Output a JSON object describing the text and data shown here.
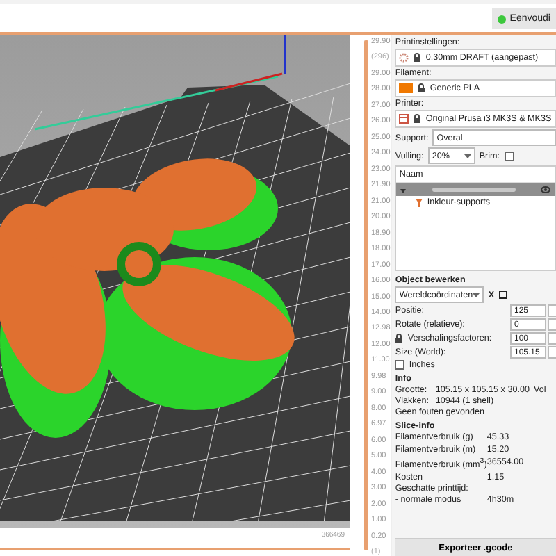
{
  "topbar": {
    "mode": {
      "label": "Eenvoudi",
      "color": "#3cc83c"
    }
  },
  "viewport": {
    "footer": "366469"
  },
  "horizontal_slider": {
    "level": 1
  },
  "layer_slider": {
    "level": 1,
    "top_label": "29.90",
    "top_sub": "(296)",
    "ticks": [
      "29.00",
      "28.00",
      "27.00",
      "26.00",
      "25.00",
      "24.00",
      "23.00",
      "21.90",
      "21.00",
      "20.00",
      "18.90",
      "18.00",
      "17.00",
      "16.00",
      "15.00",
      "14.00",
      "12.98",
      "12.00",
      "11.00",
      "9.98",
      "9.00",
      "8.00",
      "6.97",
      "6.00",
      "5.00",
      "4.00",
      "3.00",
      "2.00",
      "1.00"
    ],
    "bottom_label": "0.20",
    "bottom_sub": "(1)"
  },
  "panel": {
    "print_settings": {
      "label": "Printinstellingen:",
      "value": "0.30mm DRAFT (aangepast)"
    },
    "filament": {
      "label": "Filament:",
      "value": "Generic PLA",
      "color": "#f07800"
    },
    "printer": {
      "label": "Printer:",
      "value": "Original Prusa i3 MK3S & MK3S"
    },
    "support": {
      "label": "Support:",
      "value": "Overal"
    },
    "infill": {
      "label": "Vulling:",
      "value": "20%"
    },
    "brim": {
      "label": "Brim:",
      "checked": false
    },
    "object_list": {
      "header": "Naam",
      "items": [
        {
          "selected": true,
          "expanded": true,
          "children": [
            {
              "label": "Inkleur-supports",
              "selected": false
            }
          ]
        }
      ]
    },
    "object_edit": {
      "title": "Object bewerken",
      "coords": "Wereldcoördinaten",
      "axis": "X",
      "rows": [
        {
          "label": "Positie:",
          "value": "125"
        },
        {
          "label": "Rotate (relatieve):",
          "value": "0"
        },
        {
          "label": "Verschalingsfactoren:",
          "value": "100"
        },
        {
          "label": "Size (World):",
          "value": "105.15"
        }
      ],
      "inches": {
        "label": "Inches",
        "checked": false
      }
    },
    "info": {
      "title": "Info",
      "rows": [
        {
          "label": "Grootte:",
          "value": "105.15 x 105.15 x 30.00",
          "trailing": "Vol"
        },
        {
          "label": "Vlakken:",
          "value": "10944 (1 shell)"
        }
      ],
      "message": "Geen fouten gevonden"
    },
    "slice_info": {
      "title": "Slice-info",
      "rows": [
        {
          "label": "Filamentverbruik (g)",
          "value": "45.33"
        },
        {
          "label": "Filamentverbruik (m)",
          "value": "15.20"
        },
        {
          "label": "Filamentverbruik (mm$^{3}$)",
          "value": "36554.00"
        },
        {
          "label": "Kosten",
          "value": "1.15"
        }
      ],
      "time_title": "Geschatte printtijd:",
      "time_rows": [
        {
          "label": "- normale modus",
          "value": "4h30m"
        }
      ]
    },
    "export_button": "Exporteer .gcode"
  }
}
